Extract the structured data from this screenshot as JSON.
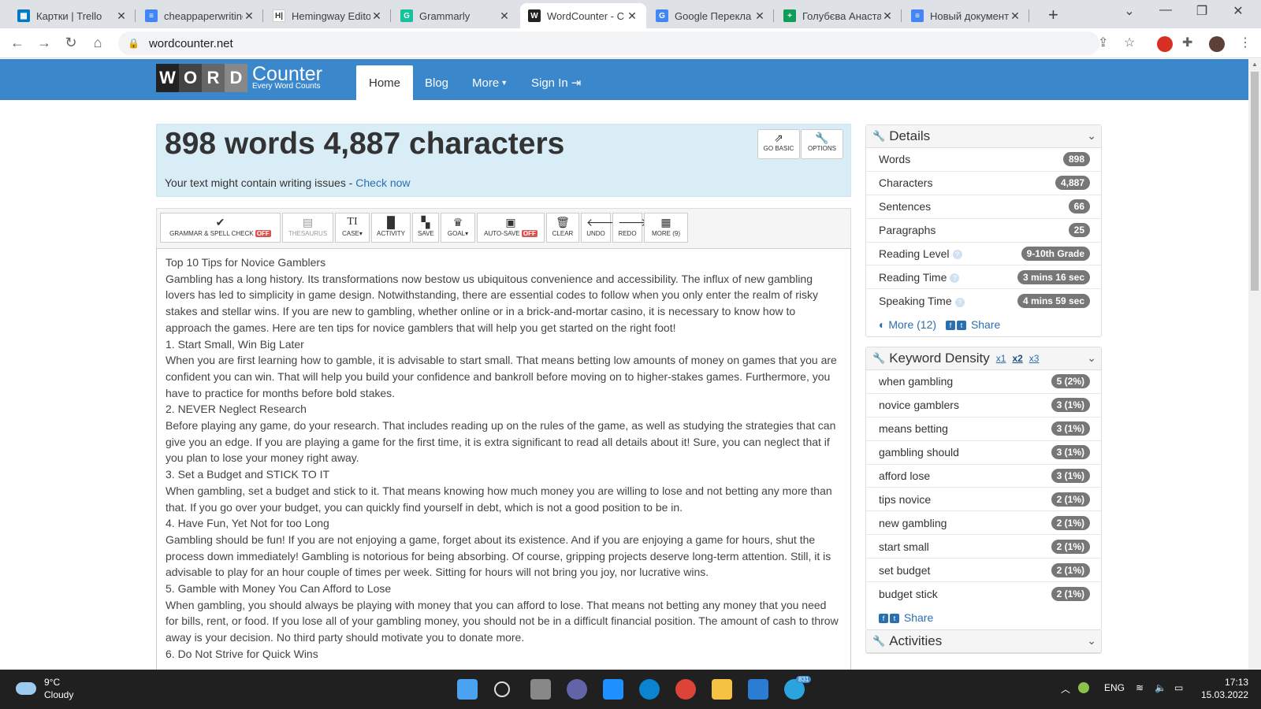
{
  "browser": {
    "tabs": [
      {
        "title": "Картки | Trello",
        "color": "#0079bf",
        "glyph": "▦"
      },
      {
        "title": "cheappaperwriting",
        "color": "#4285f4",
        "glyph": "≡"
      },
      {
        "title": "Hemingway Edito",
        "color": "#ffffff",
        "glyph": "H|"
      },
      {
        "title": "Grammarly",
        "color": "#15c39a",
        "glyph": "G"
      },
      {
        "title": "WordCounter - C",
        "color": "#222222",
        "glyph": "W"
      },
      {
        "title": "Google Перекла",
        "color": "#4285f4",
        "glyph": "G"
      },
      {
        "title": "Голубєва Анаста",
        "color": "#0f9d58",
        "glyph": "+"
      },
      {
        "title": "Новый документ",
        "color": "#4285f4",
        "glyph": "≡"
      }
    ],
    "active_tab": 4,
    "url": "wordcounter.net"
  },
  "header": {
    "logo_letters": [
      "W",
      "O",
      "R",
      "D"
    ],
    "logo_title": "Counter",
    "logo_tagline": "Every Word Counts",
    "nav": {
      "home": "Home",
      "blog": "Blog",
      "more": "More",
      "signin": "Sign In"
    }
  },
  "stats": {
    "headline": "898 words 4,887 characters",
    "issues_text": "Your text might contain writing issues - ",
    "issues_link": "Check now",
    "go_basic": "GO BASIC",
    "options": "OPTIONS"
  },
  "tools": {
    "grammar": "GRAMMAR & SPELL CHECK",
    "off": "OFF",
    "thesaurus": "THESAURUS",
    "case": "CASE",
    "activity": "ACTIVITY",
    "save": "SAVE",
    "goal": "GOAL",
    "autosave": "AUTO-SAVE",
    "clear": "CLEAR",
    "undo": "UNDO",
    "redo": "REDO",
    "more": "MORE (9)"
  },
  "document": {
    "lines": [
      "Top 10 Tips for Novice Gamblers",
      "Gambling has a long history. Its transformations now bestow us ubiquitous convenience and accessibility. The influx of new gambling lovers has led to simplicity in game design. Notwithstanding, there are essential codes to follow when you only enter the realm of risky stakes and stellar wins. If you are new to gambling, whether online or in a brick-and-mortar casino, it is necessary to know how to approach the games. Here are ten tips for novice gamblers that will help you get started on the right foot!",
      "1. Start Small, Win Big Later",
      "When you are first learning how to gamble, it is advisable to start small. That means betting low amounts of money on games that you are confident you can win. That will help you build your confidence and bankroll before moving on to higher-stakes games. Furthermore, you have to practice for months before bold stakes.",
      "2. NEVER Neglect Research",
      "Before playing any game, do your research. That includes reading up on the rules of the game, as well as studying the strategies that can give you an edge. If you are playing a game for the first time, it is extra significant to read all details about it! Sure, you can neglect that if you plan to lose your money right away.",
      "3. Set a Budget and STICK TO IT",
      "When gambling, set a budget and stick to it. That means knowing how much money you are willing to lose and not betting any more than that. If you go over your budget, you can quickly find yourself in debt, which is not a good position to be in.",
      "4. Have Fun, Yet Not for too Long",
      "Gambling should be fun! If you are not enjoying a game, forget about its existence. And if you are enjoying a game for hours, shut the process down immediately! Gambling is notorious for being absorbing. Of course, gripping projects deserve long-term attention. Still, it is advisable to play for an hour couple of times per week. Sitting for hours will not bring you joy, nor lucrative wins.",
      "5. Gamble with Money You Can Afford to Lose",
      "When gambling, you should always be playing with money that you can afford to lose. That means not betting any money that you need for bills, rent, or food. If you lose all of your gambling money, you should not be in a difficult financial position. The amount of cash to throw away is your decision. No third party should motivate you to donate more.",
      "6. Do Not Strive for Quick Wins"
    ]
  },
  "details": {
    "title": "Details",
    "rows": [
      {
        "label": "Words",
        "value": "898"
      },
      {
        "label": "Characters",
        "value": "4,887"
      },
      {
        "label": "Sentences",
        "value": "66"
      },
      {
        "label": "Paragraphs",
        "value": "25"
      },
      {
        "label": "Reading Level",
        "value": "9-10th Grade"
      },
      {
        "label": "Reading Time",
        "value": "3 mins 16 sec"
      },
      {
        "label": "Speaking Time",
        "value": "4 mins 59 sec"
      }
    ],
    "more": "More (12)",
    "share": "Share"
  },
  "keywords": {
    "title": "Keyword Density",
    "x1": "x1",
    "x2": "x2",
    "x3": "x3",
    "rows": [
      {
        "label": "when gambling",
        "value": "5 (2%)"
      },
      {
        "label": "novice gamblers",
        "value": "3 (1%)"
      },
      {
        "label": "means betting",
        "value": "3 (1%)"
      },
      {
        "label": "gambling should",
        "value": "3 (1%)"
      },
      {
        "label": "afford lose",
        "value": "3 (1%)"
      },
      {
        "label": "tips novice",
        "value": "2 (1%)"
      },
      {
        "label": "new gambling",
        "value": "2 (1%)"
      },
      {
        "label": "start small",
        "value": "2 (1%)"
      },
      {
        "label": "set budget",
        "value": "2 (1%)"
      },
      {
        "label": "budget stick",
        "value": "2 (1%)"
      }
    ],
    "share": "Share"
  },
  "activities": {
    "title": "Activities"
  },
  "taskbar": {
    "temp": "9°C",
    "weather": "Cloudy",
    "lang": "ENG",
    "time": "17:13",
    "date": "15.03.2022",
    "telegram_badge": "831"
  }
}
